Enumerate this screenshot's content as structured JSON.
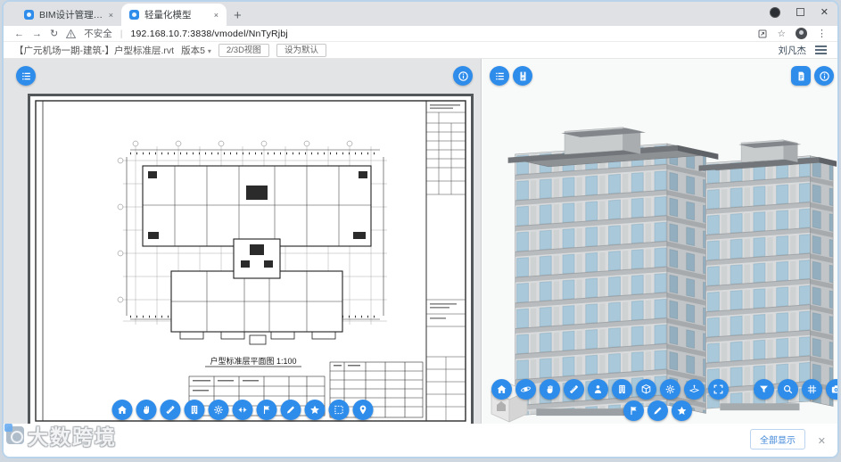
{
  "browser": {
    "tabs": [
      {
        "title": "BIM设计管理平台 项目文件",
        "active": false,
        "close": "×"
      },
      {
        "title": "轻量化模型",
        "active": true,
        "close": "×"
      }
    ],
    "new_tab": "+",
    "back": "←",
    "forward": "→",
    "reload": "↻",
    "security_label": "不安全",
    "url": "192.168.10.7:3838/vmodel/NnTyRjbj",
    "bookmark_star": "☆",
    "kebab": "⋮",
    "close_window": "✕"
  },
  "app_toolbar": {
    "file_label": "【广元机场一期-建筑-】户型标准层.rvt",
    "version_label": "版本5",
    "version_caret": "▾",
    "view_toggle_button": "2/3D视图",
    "set_default_button": "设为默认",
    "user_name": "刘凡杰"
  },
  "left_panel": {
    "corner_buttons": [
      "view-list",
      "info"
    ],
    "plan_title": "户型标准层平面图  1:100",
    "toolbar_buttons": [
      "home",
      "pan",
      "measure",
      "floors",
      "components",
      "section-cut",
      "issue-flag",
      "markup",
      "favorite",
      "box-select",
      "locate"
    ]
  },
  "right_panel": {
    "corner_buttons_left": [
      "model-tree",
      "viewpoint-list"
    ],
    "corner_buttons_right": [
      "document",
      "info"
    ],
    "toolbar_row1": [
      "home",
      "orbit",
      "pan",
      "measure",
      "walkthrough",
      "floors",
      "model-cube",
      "settings",
      "section-plane",
      "fullscreen",
      "filter",
      "search",
      "grid",
      "snapshot",
      "locate-target"
    ],
    "toolbar_row2": [
      "issue-flag",
      "markup",
      "favorite"
    ]
  },
  "bottom_bar": {
    "watermark_text": "大数跨境",
    "show_all_button": "全部显示",
    "close": "✕"
  },
  "colors": {
    "accent_blue": "#2e8ceb",
    "chrome_strip": "#dfe1e5",
    "left_canvas": "#e3e4e6",
    "sheet_border": "#53575a",
    "facade_glass": "#a9c8da",
    "facade_wall": "#d9dbdc",
    "roof": "#8e9194"
  }
}
